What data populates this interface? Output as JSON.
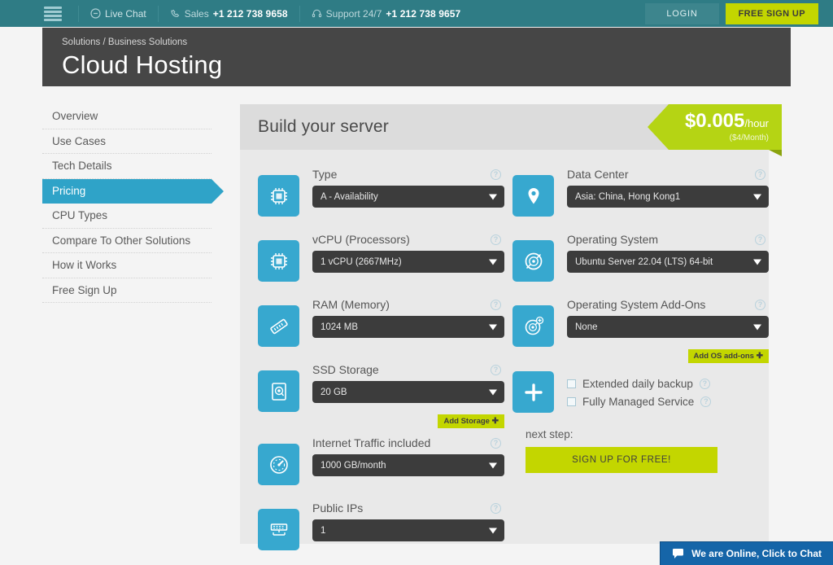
{
  "topbar": {
    "menu_icon": "hamburger-icon",
    "live_chat": "Live Chat",
    "sales_label": "Sales",
    "sales_phone": "+1 212 738 9658",
    "support_label": "Support 24/7",
    "support_phone": "+1 212 738 9657",
    "login": "LOGIN",
    "signup": "FREE SIGN UP",
    "bg_color": "#2f7c85",
    "accent_green": "#c3d600"
  },
  "header": {
    "breadcrumb_root": "Solutions",
    "breadcrumb_sep": "/",
    "breadcrumb_current": "Business Solutions",
    "title": "Cloud Hosting"
  },
  "sidebar": {
    "items": [
      {
        "label": "Overview",
        "active": false
      },
      {
        "label": "Use Cases",
        "active": false
      },
      {
        "label": "Tech Details",
        "active": false
      },
      {
        "label": "Pricing",
        "active": true
      },
      {
        "label": "CPU Types",
        "active": false
      },
      {
        "label": "Compare To Other Solutions",
        "active": false
      },
      {
        "label": "How it Works",
        "active": false
      },
      {
        "label": "Free Sign Up",
        "active": false
      }
    ],
    "active_color": "#2fa3c8"
  },
  "panel": {
    "title": "Build your server",
    "price_amount": "$0.005",
    "price_unit": "/hour",
    "price_sub": "($4/Month)",
    "price_color": "#b5d414"
  },
  "fields_left": [
    {
      "name": "type",
      "label": "Type",
      "value": "A - Availability",
      "icon": "cpu-chip-icon",
      "badge": null
    },
    {
      "name": "vcpu",
      "label": "vCPU (Processors)",
      "value": "1 vCPU (2667MHz)",
      "icon": "cpu-chip-icon",
      "badge": null
    },
    {
      "name": "ram",
      "label": "RAM (Memory)",
      "value": "1024 MB",
      "icon": "memory-stick-icon",
      "badge": null
    },
    {
      "name": "ssd-storage",
      "label": "SSD Storage",
      "value": "20 GB",
      "icon": "hard-drive-icon",
      "badge": "Add Storage"
    },
    {
      "name": "internet-traffic",
      "label": "Internet Traffic included",
      "value": "1000 GB/month",
      "icon": "speedometer-icon",
      "badge": null
    },
    {
      "name": "public-ips",
      "label": "Public IPs",
      "value": "1",
      "icon": "network-icon",
      "badge": null
    }
  ],
  "fields_right": [
    {
      "name": "data-center",
      "label": "Data Center",
      "value": "Asia: China, Hong Kong1",
      "icon": "map-pin-icon",
      "badge": null
    },
    {
      "name": "operating-system",
      "label": "Operating System",
      "value": "Ubuntu Server 22.04 (LTS) 64-bit",
      "icon": "disc-icon",
      "badge": null
    },
    {
      "name": "os-addons",
      "label": "Operating System Add-Ons",
      "value": "None",
      "icon": "disc-plus-icon",
      "badge": "Add OS add-ons"
    }
  ],
  "addons": {
    "icon": "plus-icon",
    "options": [
      {
        "label": "Extended daily backup",
        "checked": false
      },
      {
        "label": "Fully Managed Service",
        "checked": false
      }
    ]
  },
  "next_step": {
    "label": "next step:",
    "button": "SIGN UP FOR FREE!"
  },
  "chat": {
    "text": "We are Online, Click to Chat",
    "icon": "chat-bubble-icon",
    "color": "#1565a8"
  },
  "help_icon_char": "?",
  "badge_plus": "✚"
}
